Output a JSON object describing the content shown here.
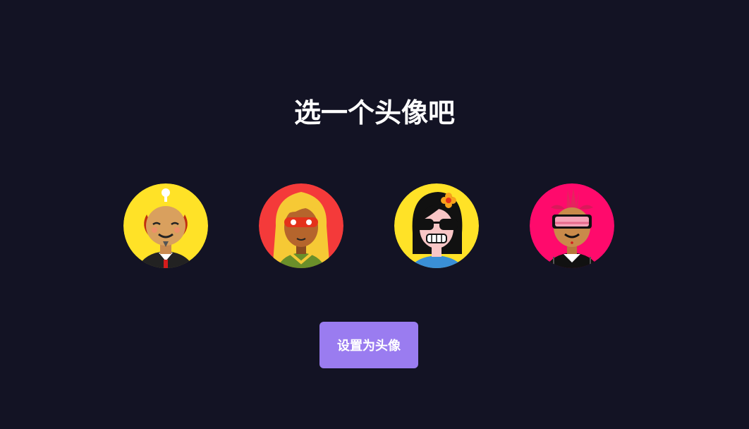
{
  "page": {
    "title": "选一个头像吧"
  },
  "avatars": [
    {
      "label": "avatar-1",
      "background": "#ffe227",
      "selected": false
    },
    {
      "label": "avatar-2",
      "background": "#f43a3a",
      "selected": false
    },
    {
      "label": "avatar-3",
      "background": "#ffe227",
      "selected": false
    },
    {
      "label": "avatar-4",
      "background": "#ff0a6c",
      "selected": false
    }
  ],
  "actions": {
    "set_avatar_label": "设置为头像"
  },
  "colors": {
    "background": "#131324",
    "button": "#9a7cf0",
    "text": "#ffffff"
  }
}
